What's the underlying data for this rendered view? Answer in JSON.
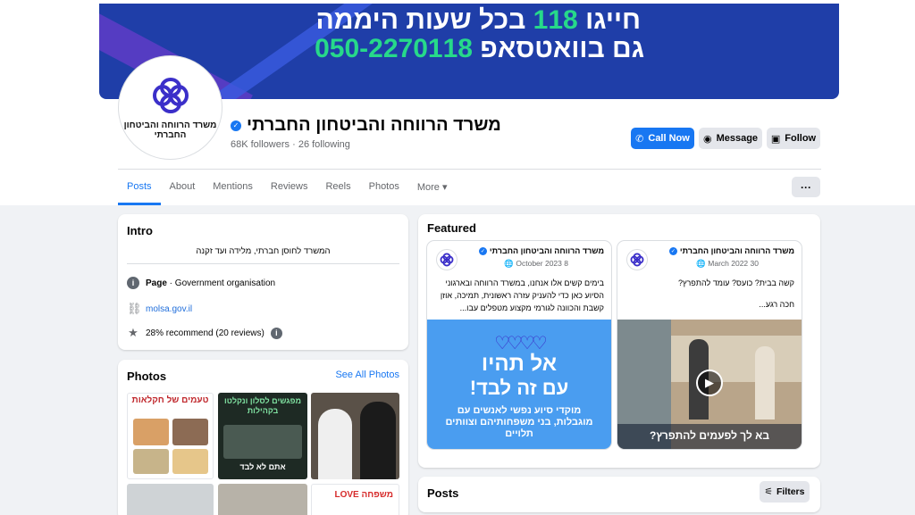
{
  "cover": {
    "line1_prefix": "חייגו",
    "line1_number": "118",
    "line1_suffix": "בכל שעות היממה",
    "line2_prefix": "גם בוואטסאפ",
    "line2_number": "050-2270118"
  },
  "profile": {
    "avatar_text": "משרד הרווחה והביטחון החברתי",
    "name": "משרד הרווחה והביטחון החברתי",
    "followers": "68K followers",
    "following": "26 following"
  },
  "actions": {
    "call": "Call Now",
    "message": "Message",
    "follow": "Follow"
  },
  "tabs": [
    "Posts",
    "About",
    "Mentions",
    "Reviews",
    "Reels",
    "Photos",
    "More"
  ],
  "more_menu": "···",
  "intro": {
    "title": "Intro",
    "bio": "המשרד לחוסן חברתי, מלידה ועד זקנה",
    "page_label": "Page",
    "page_category": " · Government organisation",
    "website": "molsa.gov.il",
    "recommend": "28% recommend (20 reviews)"
  },
  "photos": {
    "title": "Photos",
    "see_all": "See All Photos",
    "p1_title": "טעמים של חקלאות",
    "p2_title": "מפגשים לסלון ונקלטו בקהילות",
    "p2_sub": "אתם לא לבד",
    "p6_title": "משפחה LOVE"
  },
  "featured": {
    "title": "Featured",
    "cards": [
      {
        "author": "משרד הרווחה והביטחון החברתי",
        "date": "8 October 2023",
        "text": "בימים קשים אלו אנחנו, במשרד הרווחה ובארגוני הסיוע כאן כדי להעניק עזרה ראשונית, תמיכה, אוזן קשבת והכוונה לגורמי מקצוע מטפלים עבו...",
        "media_line1": "אל תהיו",
        "media_line2": "עם זה לבד!",
        "media_sub": "מוקדי סיוע נפשי לאנשים עם מוגבלות, בני משפחותיהם וצוותים תלויים"
      },
      {
        "author": "משרד הרווחה והביטחון החברתי",
        "date": "30 March 2022",
        "text": "קשה בבית? כועס? עומד להתפרץ?",
        "text2": "חכה רגע...",
        "caption": "בא לך לפעמים להתפרץ?"
      }
    ]
  },
  "posts": {
    "title": "Posts",
    "filters": "Filters"
  },
  "colors": {
    "brand": "#1877f2",
    "cover": "#1f3ea8",
    "accent_green": "#27d98a"
  }
}
